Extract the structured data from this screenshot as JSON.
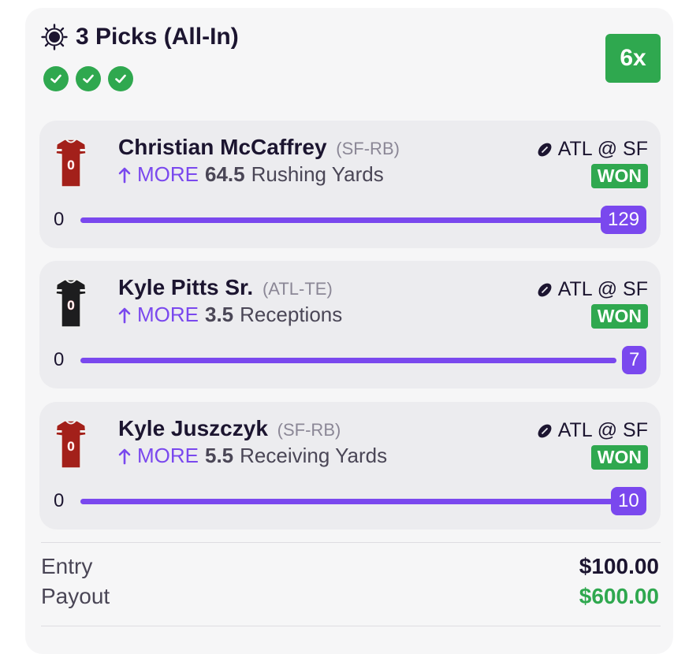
{
  "entry": {
    "title": "3 Picks (All-In)",
    "multiplier": "6x",
    "check_count": 3
  },
  "picks": [
    {
      "player": "Christian McCaffrey",
      "position": "(SF-RB)",
      "direction": "MORE",
      "line": "64.5",
      "stat": "Rushing Yards",
      "matchup": "ATL @ SF",
      "status": "WON",
      "start": "0",
      "result": "129",
      "progress": 1.0,
      "jersey": {
        "color": "#a3201a",
        "number": "0"
      }
    },
    {
      "player": "Kyle Pitts Sr.",
      "position": "(ATL-TE)",
      "direction": "MORE",
      "line": "3.5",
      "stat": "Receptions",
      "matchup": "ATL @ SF",
      "status": "WON",
      "start": "0",
      "result": "7",
      "progress": 1.0,
      "jersey": {
        "color": "#1d1d1f",
        "number": "0"
      }
    },
    {
      "player": "Kyle Juszczyk",
      "position": "(SF-RB)",
      "direction": "MORE",
      "line": "5.5",
      "stat": "Receiving Yards",
      "matchup": "ATL @ SF",
      "status": "WON",
      "start": "0",
      "result": "10",
      "progress": 1.0,
      "jersey": {
        "color": "#a3201a",
        "number": "0"
      }
    }
  ],
  "summary": {
    "entry_label": "Entry",
    "entry_value": "$100.00",
    "payout_label": "Payout",
    "payout_value": "$600.00"
  },
  "colors": {
    "accent": "#7a48ee",
    "success": "#2fa84f",
    "text": "#1c1530"
  }
}
